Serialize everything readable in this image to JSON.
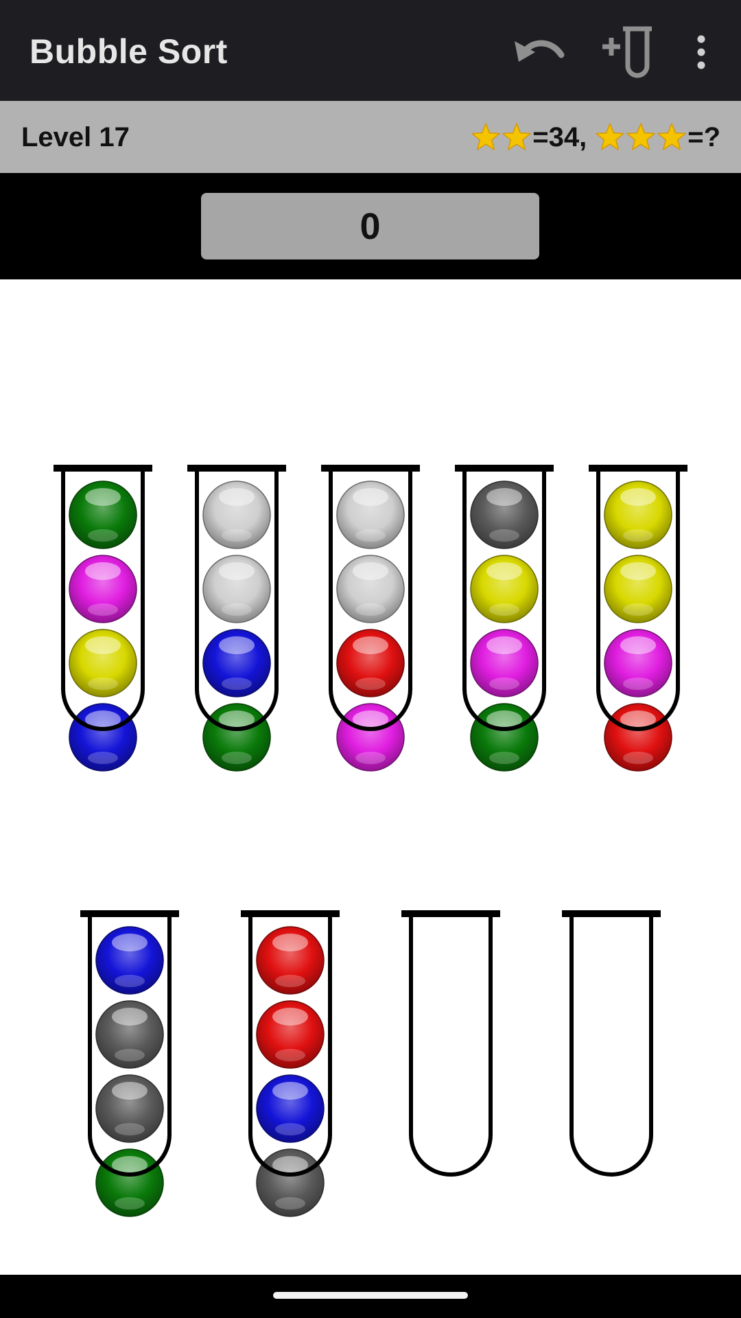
{
  "app": {
    "title": "Bubble Sort",
    "actions": [
      {
        "icon": "undo-icon"
      },
      {
        "icon": "add-tube-icon"
      },
      {
        "icon": "more-vert-icon"
      }
    ]
  },
  "level": {
    "label": "Level 17",
    "two_star_count": 2,
    "two_star_text": "=34,",
    "three_star_count": 3,
    "three_star_text": "=?"
  },
  "moves": {
    "value": "0"
  },
  "colors": {
    "green": "#0a7a0a",
    "magenta": "#e01ee0",
    "yellow": "#d8d800",
    "blue": "#1414d8",
    "white": "#cfcfcf",
    "gray": "#5a5a5a",
    "red": "#e01010",
    "star": "#f5c400",
    "appbar": "#1e1e22",
    "levelbar": "#b2b2b2",
    "counter": "#a6a6a6"
  },
  "tubes": [
    {
      "row": 1,
      "balls": [
        "green",
        "magenta",
        "yellow",
        "blue"
      ]
    },
    {
      "row": 1,
      "balls": [
        "white",
        "white",
        "blue",
        "green"
      ]
    },
    {
      "row": 1,
      "balls": [
        "white",
        "white",
        "red",
        "magenta"
      ]
    },
    {
      "row": 1,
      "balls": [
        "gray",
        "yellow",
        "magenta",
        "green"
      ]
    },
    {
      "row": 1,
      "balls": [
        "yellow",
        "yellow",
        "magenta",
        "red"
      ]
    },
    {
      "row": 2,
      "balls": [
        "blue",
        "gray",
        "gray",
        "green"
      ]
    },
    {
      "row": 2,
      "balls": [
        "red",
        "red",
        "blue",
        "gray"
      ]
    },
    {
      "row": 2,
      "balls": []
    },
    {
      "row": 2,
      "balls": []
    }
  ]
}
